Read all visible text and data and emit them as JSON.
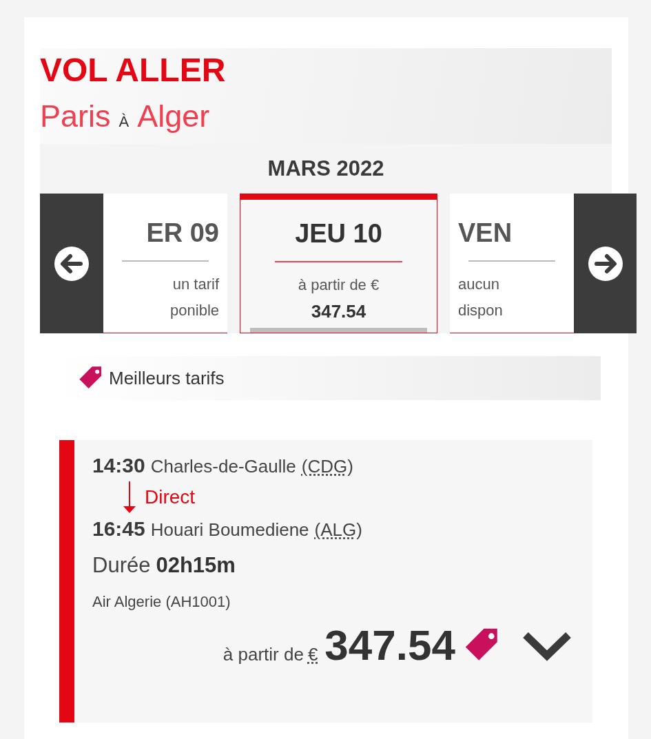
{
  "heading": "VOL ALLER",
  "route": {
    "origin": "Paris",
    "connector": "À",
    "destination": "Alger"
  },
  "month": "MARS 2022",
  "dates": [
    {
      "day": "ER 09",
      "kind": "unavailable",
      "lines": [
        "un tarif",
        "ponible"
      ],
      "selected": false
    },
    {
      "day": "JEU 10",
      "kind": "fare",
      "label": "à partir de €",
      "price": "347.54",
      "selected": true
    },
    {
      "day": "VEN",
      "kind": "unavailable",
      "lines": [
        "aucun",
        "dispon"
      ],
      "selected": false
    }
  ],
  "best_fares": "Meilleurs tarifs",
  "flight": {
    "departure": {
      "time": "14:30",
      "airport": "Charles-de-Gaulle",
      "code": "(CDG)"
    },
    "stops": "Direct",
    "arrival": {
      "time": "16:45",
      "airport": "Houari Boumediene",
      "code": "(ALG)"
    },
    "duration_label": "Durée",
    "duration": "02h15m",
    "airline": "Air Algerie (AH1001)",
    "price_label": "à partir de",
    "currency": "€",
    "price": "347.54",
    "expanded": false
  }
}
